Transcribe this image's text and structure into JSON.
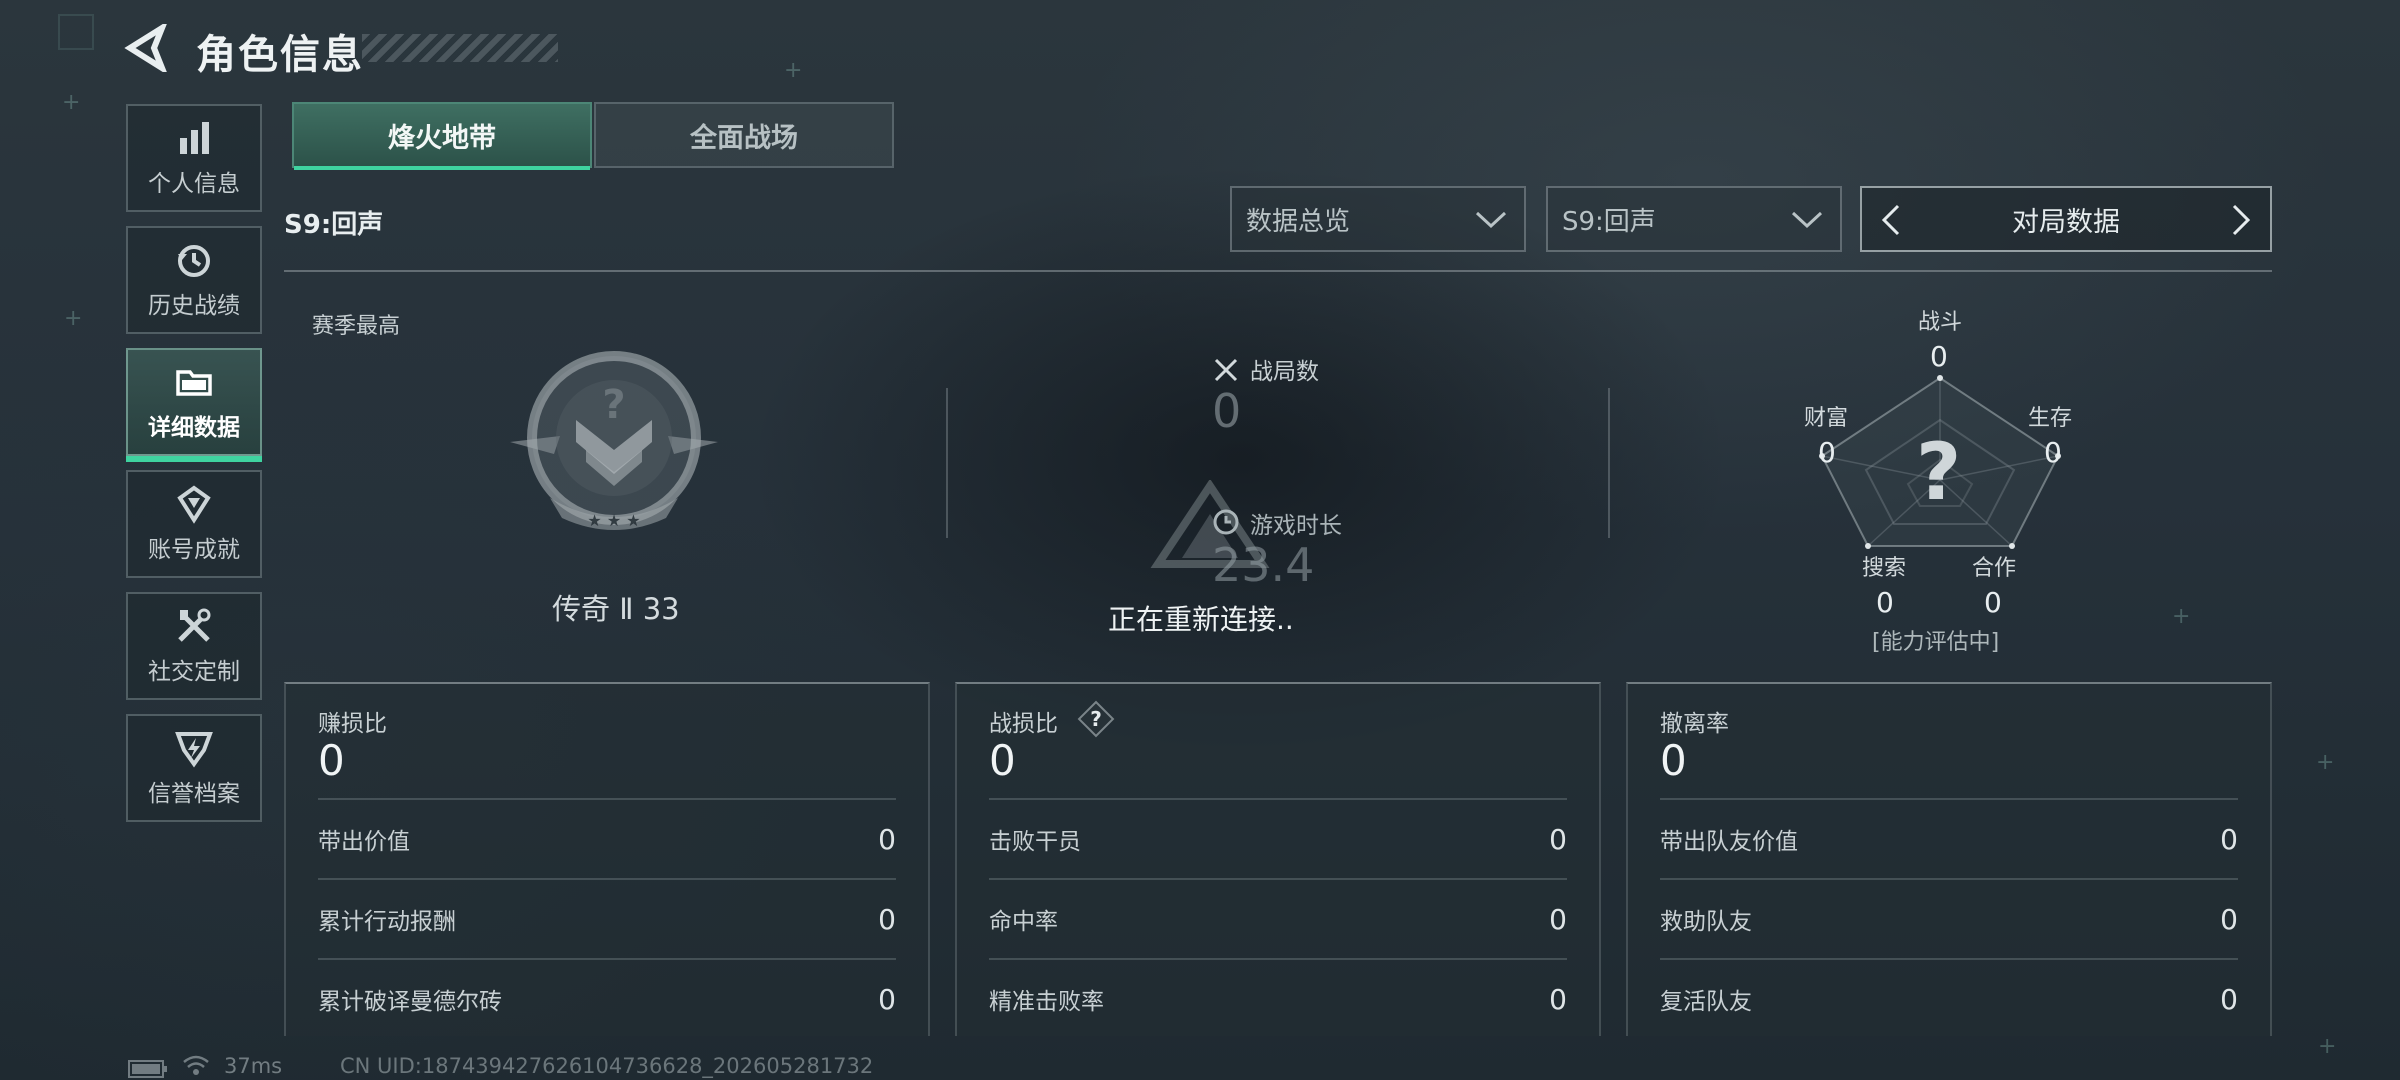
{
  "header": {
    "title": "角色信息"
  },
  "sidebar": {
    "items": [
      {
        "label": "个人信息",
        "icon": "bar-chart-icon"
      },
      {
        "label": "历史战绩",
        "icon": "history-icon"
      },
      {
        "label": "详细数据",
        "icon": "folder-icon",
        "active": true
      },
      {
        "label": "账号成就",
        "icon": "medal-icon"
      },
      {
        "label": "社交定制",
        "icon": "tools-icon"
      },
      {
        "label": "信誉档案",
        "icon": "shield-badge-icon"
      }
    ]
  },
  "tabs": [
    {
      "label": "烽火地带",
      "active": true
    },
    {
      "label": "全面战场",
      "active": false
    }
  ],
  "season": {
    "label": "S9:回声"
  },
  "filters": {
    "data_view": "数据总览",
    "season_select": "S9:回声",
    "pager_label": "对局数据"
  },
  "overview": {
    "season_best": "赛季最高",
    "rank": "传奇 Ⅱ 33",
    "matches_label": "战局数",
    "matches_value": "0",
    "playtime_label": "游戏时长",
    "playtime_value": "23.4",
    "reconnect_text": "正在重新连接.."
  },
  "radar": {
    "status": "[能力评估中]",
    "axes": [
      {
        "label": "战斗",
        "value": "0"
      },
      {
        "label": "生存",
        "value": "0"
      },
      {
        "label": "合作",
        "value": "0"
      },
      {
        "label": "搜索",
        "value": "0"
      },
      {
        "label": "财富",
        "value": "0"
      }
    ],
    "center_mark": "?"
  },
  "cards": [
    {
      "title": "赚损比",
      "value": "0",
      "rows": [
        {
          "label": "带出价值",
          "value": "0"
        },
        {
          "label": "累计行动报酬",
          "value": "0"
        },
        {
          "label": "累计破译曼德尔砖",
          "value": "0"
        }
      ]
    },
    {
      "title": "战损比",
      "value": "0",
      "help": "?",
      "rows": [
        {
          "label": "击败干员",
          "value": "0"
        },
        {
          "label": "命中率",
          "value": "0"
        },
        {
          "label": "精准击败率",
          "value": "0"
        }
      ]
    },
    {
      "title": "撤离率",
      "value": "0",
      "rows": [
        {
          "label": "带出队友价值",
          "value": "0"
        },
        {
          "label": "救助队友",
          "value": "0"
        },
        {
          "label": "复活队友",
          "value": "0"
        }
      ]
    }
  ],
  "footer": {
    "ping": "37ms",
    "uid": "CN UID:1874394276261047366​28_202605281732"
  },
  "colors": {
    "accent": "#3fd3a0",
    "active_tab": "#3f6f62",
    "background": "#26313a"
  }
}
